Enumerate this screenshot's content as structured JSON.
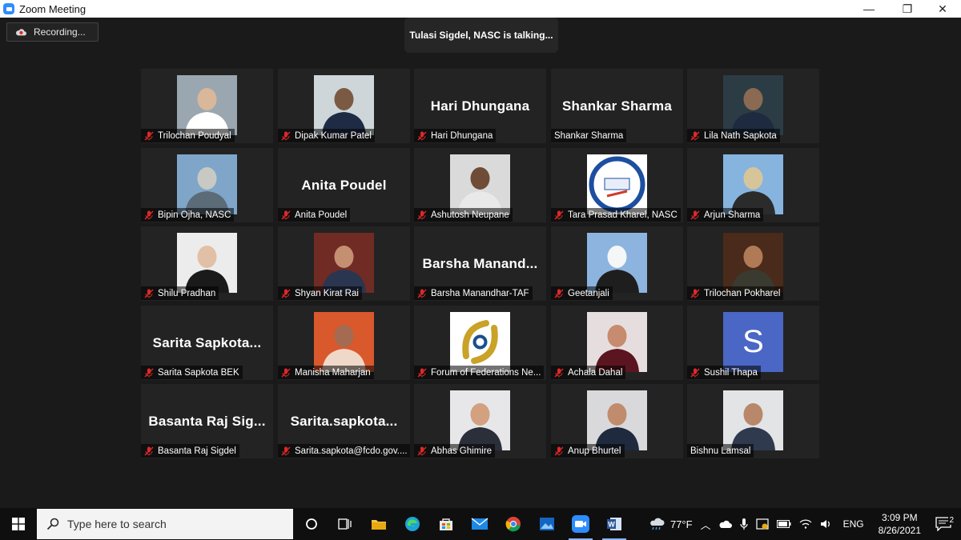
{
  "window": {
    "title": "Zoom Meeting",
    "minimize": "—",
    "maximize": "❐",
    "close": "✕"
  },
  "recording": {
    "label": "Recording..."
  },
  "speaker": {
    "text": "Tulasi Sigdel, NASC is talking..."
  },
  "participants": [
    {
      "name": "Trilochan Poudyal",
      "avatar": "photo",
      "muted": true
    },
    {
      "name": "Dipak Kumar Patel",
      "avatar": "photo",
      "muted": true
    },
    {
      "name": "Hari Dhungana",
      "display": "Hari Dhungana",
      "muted": true
    },
    {
      "name": "Shankar Sharma",
      "display": "Shankar Sharma",
      "muted": false
    },
    {
      "name": "Lila Nath Sapkota",
      "avatar": "photo",
      "muted": true
    },
    {
      "name": "Bipin Ojha, NASC",
      "avatar": "photo",
      "muted": true
    },
    {
      "name": "Anita Poudel",
      "display": "Anita Poudel",
      "muted": true
    },
    {
      "name": "Ashutosh Neupane",
      "avatar": "photo",
      "muted": true
    },
    {
      "name": "Tara Prasad Kharel, NASC",
      "avatar": "logo",
      "muted": true
    },
    {
      "name": "Arjun Sharma",
      "avatar": "photo",
      "muted": true
    },
    {
      "name": "Shilu Pradhan",
      "avatar": "photo",
      "muted": true
    },
    {
      "name": "Shyan Kirat Rai",
      "avatar": "photo",
      "muted": true
    },
    {
      "name": "Barsha Manandhar-TAF",
      "display": "Barsha  Manand...",
      "muted": true
    },
    {
      "name": "Geetanjali",
      "avatar": "photo",
      "muted": true
    },
    {
      "name": "Trilochan Pokharel",
      "avatar": "photo",
      "muted": true
    },
    {
      "name": "Sarita Sapkota BEK",
      "display": "Sarita  Sapkota...",
      "muted": true
    },
    {
      "name": "Manisha Maharjan",
      "avatar": "photo",
      "muted": true
    },
    {
      "name": "Forum of Federations Ne...",
      "avatar": "logo",
      "muted": true
    },
    {
      "name": "Achala Dahal",
      "avatar": "photo",
      "muted": true
    },
    {
      "name": "Sushil Thapa",
      "avatar": "letter",
      "letter": "S",
      "muted": true
    },
    {
      "name": "Basanta Raj Sigdel",
      "display": "Basanta  Raj  Sig...",
      "muted": true
    },
    {
      "name": "Sarita.sapkota@fcdo.gov....",
      "display": "Sarita.sapkota...",
      "muted": true
    },
    {
      "name": "Abhas Ghimire",
      "avatar": "photo",
      "muted": true
    },
    {
      "name": "Anup Bhurtel",
      "avatar": "photo",
      "muted": true
    },
    {
      "name": "Bishnu Lamsal",
      "avatar": "photo",
      "muted": false
    }
  ],
  "taskbar": {
    "search_placeholder": "Type here to search",
    "weather": "77°F",
    "language": "ENG",
    "time": "3:09 PM",
    "date": "8/26/2021",
    "notifications": "2"
  },
  "colors": {
    "accent": "#2d8cff",
    "tile_bg": "#232323",
    "stage_bg": "#1a1a1a",
    "mute_red": "#e02828"
  }
}
